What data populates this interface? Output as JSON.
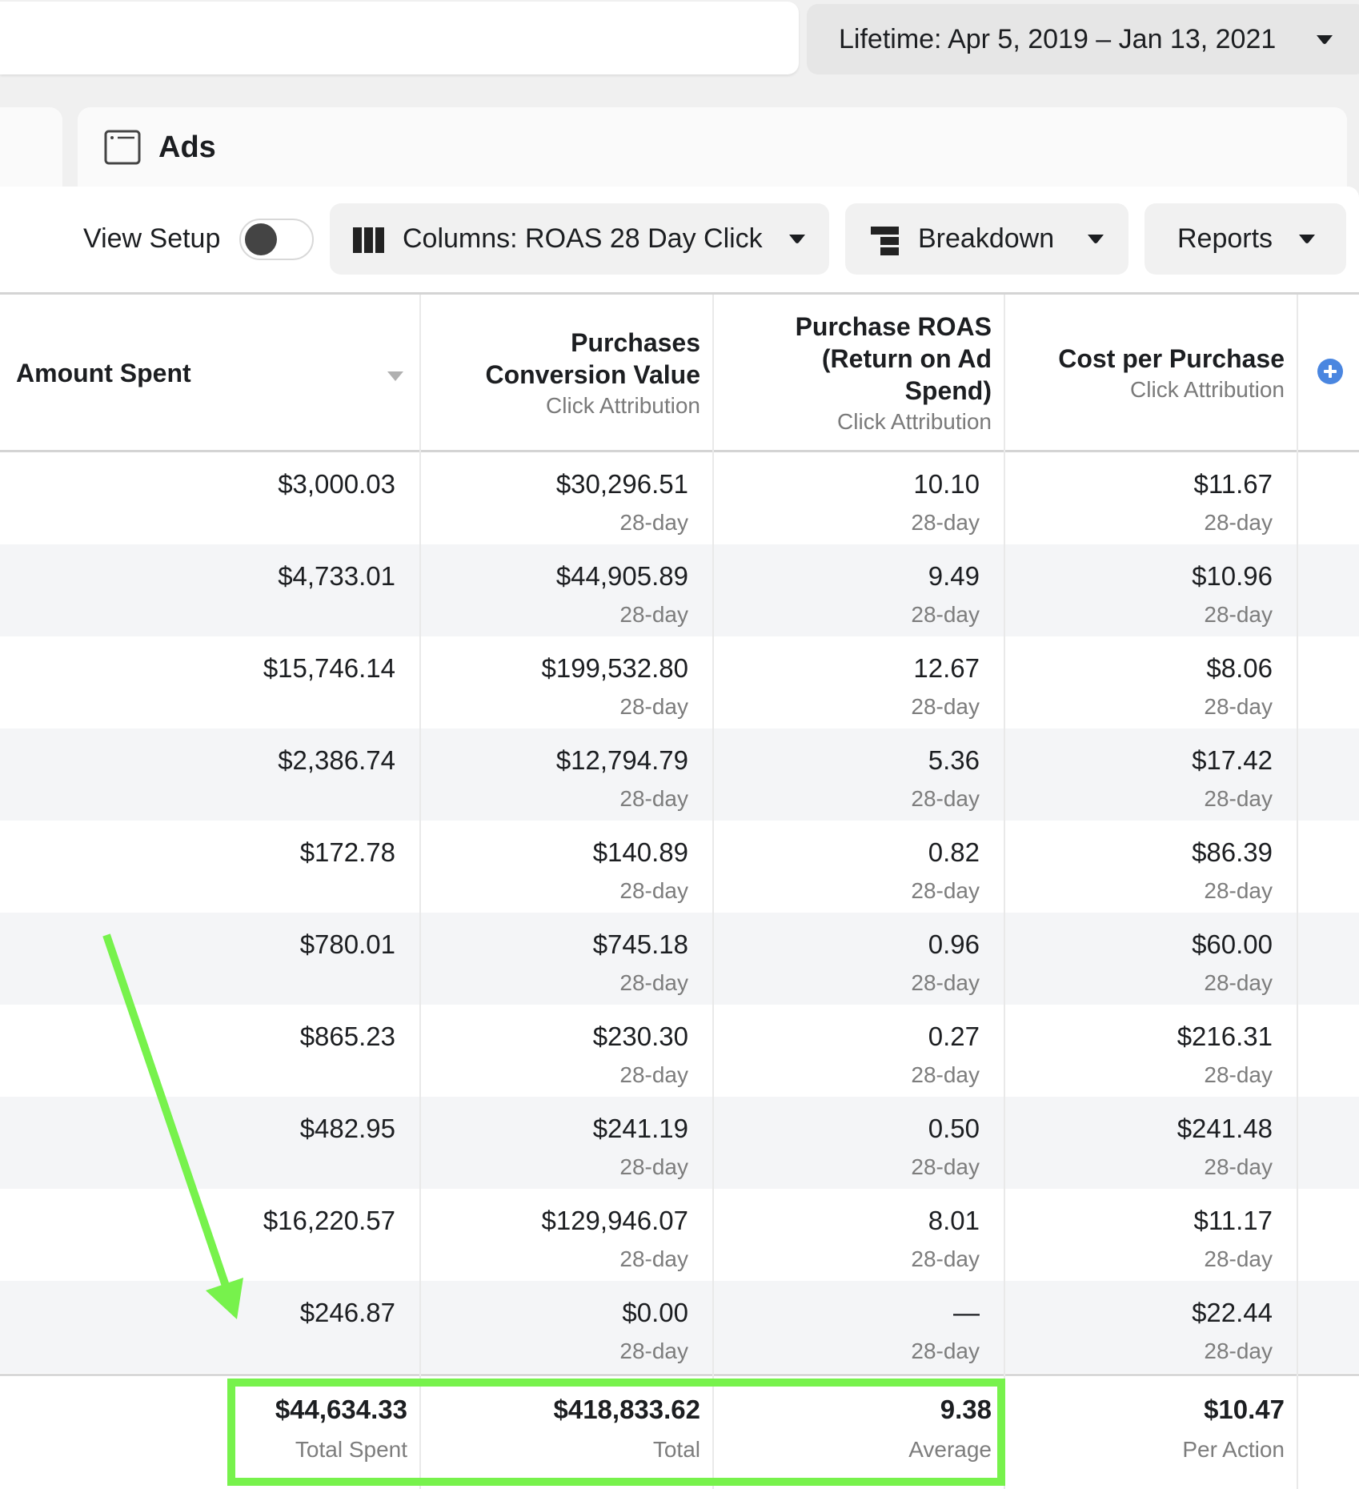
{
  "top_bar": {
    "date_range_label": "Lifetime: Apr 5, 2019 – Jan 13, 2021"
  },
  "tabs": {
    "ads": {
      "label": "Ads",
      "icon": "ad-window-icon"
    }
  },
  "toolbar": {
    "view_setup_label": "View Setup",
    "view_setup_toggle_on": false,
    "columns_label": "Columns: ROAS 28 Day Click",
    "breakdown_label": "Breakdown",
    "reports_label": "Reports"
  },
  "table": {
    "columns": [
      {
        "title": "Amount Spent",
        "subtitle": ""
      },
      {
        "title": "Purchases Conversion Value",
        "title_lines": [
          "Purchases",
          "Conversion Value"
        ],
        "subtitle": "Click Attribution"
      },
      {
        "title": "Purchase ROAS (Return on Ad Spend)",
        "title_lines": [
          "Purchase ROAS",
          "(Return on Ad",
          "Spend)"
        ],
        "subtitle": "Click Attribution"
      },
      {
        "title": "Cost per Purchase",
        "title_lines": [
          "Cost per Purchase"
        ],
        "subtitle": "Click Attribution"
      }
    ],
    "rows": [
      {
        "amount_spent": "$3,000.03",
        "purchases_value": "$30,296.51",
        "roas": "10.10",
        "cost_per_purchase": "$11.67",
        "window": "28-day"
      },
      {
        "amount_spent": "$4,733.01",
        "purchases_value": "$44,905.89",
        "roas": "9.49",
        "cost_per_purchase": "$10.96",
        "window": "28-day"
      },
      {
        "amount_spent": "$15,746.14",
        "purchases_value": "$199,532.80",
        "roas": "12.67",
        "cost_per_purchase": "$8.06",
        "window": "28-day"
      },
      {
        "amount_spent": "$2,386.74",
        "purchases_value": "$12,794.79",
        "roas": "5.36",
        "cost_per_purchase": "$17.42",
        "window": "28-day"
      },
      {
        "amount_spent": "$172.78",
        "purchases_value": "$140.89",
        "roas": "0.82",
        "cost_per_purchase": "$86.39",
        "window": "28-day"
      },
      {
        "amount_spent": "$780.01",
        "purchases_value": "$745.18",
        "roas": "0.96",
        "cost_per_purchase": "$60.00",
        "window": "28-day"
      },
      {
        "amount_spent": "$865.23",
        "purchases_value": "$230.30",
        "roas": "0.27",
        "cost_per_purchase": "$216.31",
        "window": "28-day"
      },
      {
        "amount_spent": "$482.95",
        "purchases_value": "$241.19",
        "roas": "0.50",
        "cost_per_purchase": "$241.48",
        "window": "28-day"
      },
      {
        "amount_spent": "$16,220.57",
        "purchases_value": "$129,946.07",
        "roas": "8.01",
        "cost_per_purchase": "$11.17",
        "window": "28-day"
      },
      {
        "amount_spent": "$246.87",
        "purchases_value": "$0.00",
        "roas": "—",
        "cost_per_purchase": "$22.44",
        "window": "28-day"
      }
    ],
    "totals": {
      "amount_spent": {
        "value": "$44,634.33",
        "label": "Total Spent"
      },
      "purchases_value": {
        "value": "$418,833.62",
        "label": "Total"
      },
      "roas": {
        "value": "9.38",
        "label": "Average"
      },
      "cost_per_purchase": {
        "value": "$10.47",
        "label": "Per Action"
      }
    }
  },
  "annotations": {
    "highlight_color": "#77f24c",
    "arrow_color": "#77f24c"
  }
}
